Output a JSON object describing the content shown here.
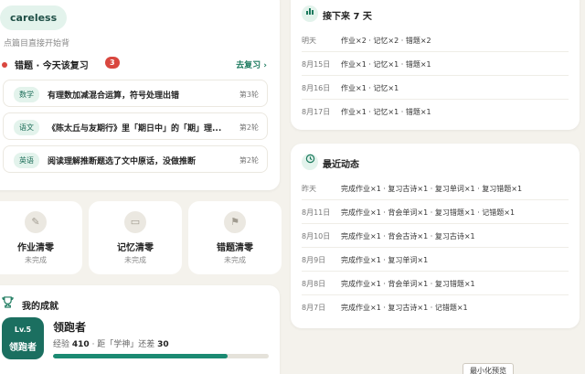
{
  "left": {
    "chip": "careless",
    "hint": "点篇目直接开始背",
    "errors": {
      "title": "错题 · 今天该复习",
      "count": "3",
      "review_link": "去复习 ›",
      "items": [
        {
          "tag": "数学",
          "text": "有理数加减混合运算，符号处理出错",
          "round": "第3轮"
        },
        {
          "tag": "语文",
          "text": "《陈太丘与友期行》里「期日中」的「期」理...",
          "round": "第2轮"
        },
        {
          "tag": "英语",
          "text": "阅读理解推断题选了文中原话，没做推断",
          "round": "第2轮"
        }
      ]
    },
    "tiles": [
      {
        "icon": "pencil-icon",
        "glyph": "✎",
        "title": "作业清零",
        "sub": "未完成"
      },
      {
        "icon": "book-icon",
        "glyph": "▭",
        "title": "记忆清零",
        "sub": "未完成"
      },
      {
        "icon": "flag-icon",
        "glyph": "⚑",
        "title": "错题清零",
        "sub": "未完成"
      }
    ],
    "achievement": {
      "title": "我的成就",
      "level": "Lv.5",
      "badge_name": "领跑者",
      "name": "领跑者",
      "exp_label": "经验",
      "exp_value": "410",
      "exp_gap_prefix": "· 距「学神」还差",
      "exp_gap_value": "30",
      "progress": 0.81
    }
  },
  "next7": {
    "title": "接下来 7 天",
    "rows": [
      {
        "date": "明天",
        "text": "作业×2 · 记忆×2 · 错题×2"
      },
      {
        "date": "8月15日",
        "text": "作业×1 · 记忆×1 · 错题×1"
      },
      {
        "date": "8月16日",
        "text": "作业×1 · 记忆×1"
      },
      {
        "date": "8月17日",
        "text": "作业×1 · 记忆×1 · 错题×1"
      }
    ]
  },
  "recent": {
    "title": "最近动态",
    "rows": [
      {
        "date": "昨天",
        "text": "完成作业×1 · 复习古诗×1 · 复习单词×1 · 复习错题×1"
      },
      {
        "date": "8月11日",
        "text": "完成作业×1 · 背会单词×1 · 复习错题×1 · 记错题×1"
      },
      {
        "date": "8月10日",
        "text": "完成作业×1 · 背会古诗×1 · 复习古诗×1"
      },
      {
        "date": "8月9日",
        "text": "完成作业×1 · 复习单词×1"
      },
      {
        "date": "8月8日",
        "text": "完成作业×1 · 背会单词×1 · 复习错题×1"
      },
      {
        "date": "8月7日",
        "text": "完成作业×1 · 复习古诗×1 · 记错题×1"
      }
    ]
  },
  "minimize_button": "最小化预览",
  "colors": {
    "accent": "#1b6f60",
    "alert": "#d9473f",
    "background": "#f4f2ec"
  }
}
